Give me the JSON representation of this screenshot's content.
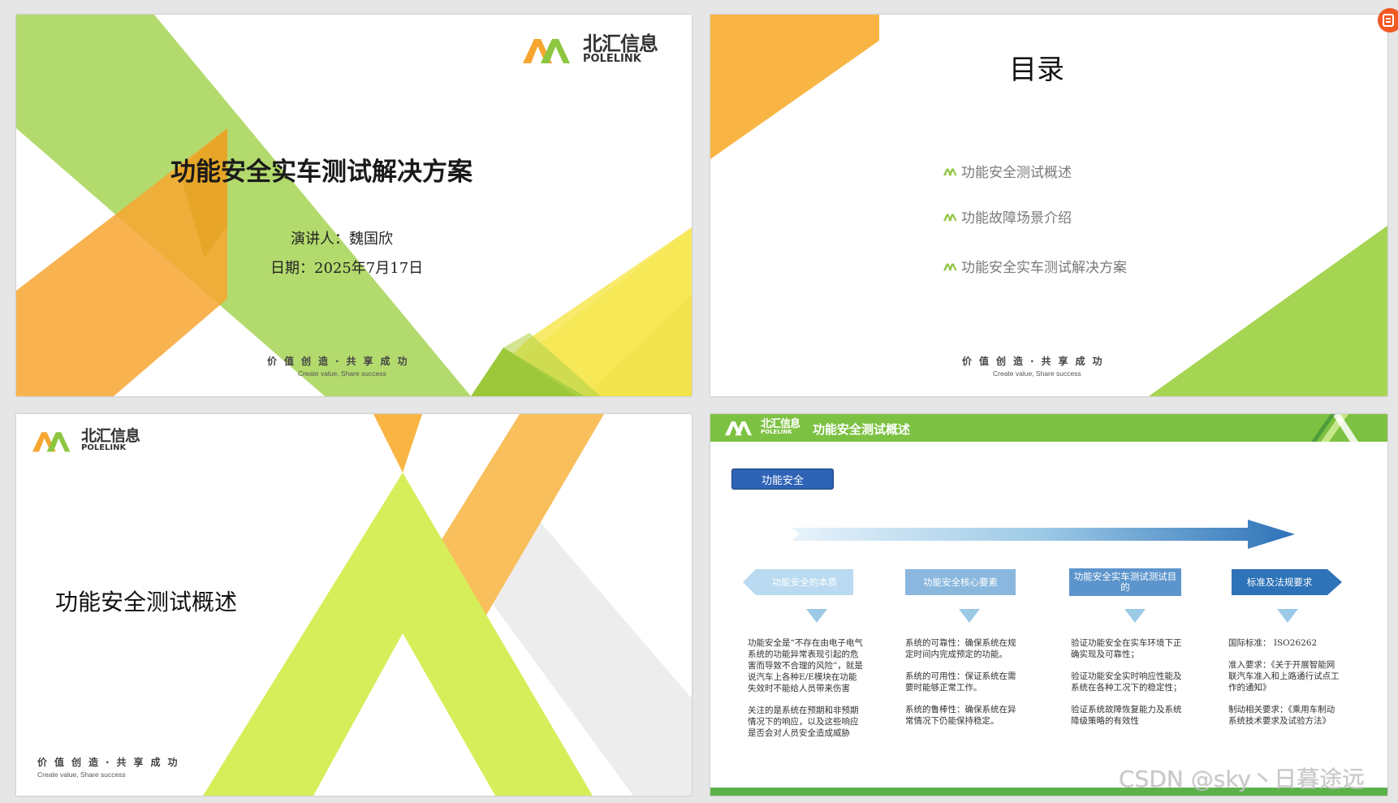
{
  "brand": {
    "name_cn": "北汇信息",
    "name_en": "POLELINK"
  },
  "slogan": {
    "cn": "价值创造·共享成功",
    "en": "Create value, Share success"
  },
  "slide1": {
    "title": "功能安全实车测试解决方案",
    "presenter": "演讲人：魏国欣",
    "date": "日期：2025年7月17日"
  },
  "slide2": {
    "title": "目录",
    "items": [
      "功能安全测试概述",
      "功能故障场景介绍",
      "功能安全实车测试解决方案"
    ]
  },
  "slide3": {
    "title": "功能安全测试概述"
  },
  "slide4": {
    "header_title": "功能安全测试概述",
    "tag": "功能安全",
    "columns": [
      {
        "title": "功能安全的本质",
        "paragraphs": [
          "功能安全是“不存在由电子电气系统的功能异常表现引起的危害而导致不合理的风险”，就是说汽车上各种E/E模块在功能失效时不能给人员带来伤害",
          "关注的是系统在预期和非预期情况下的响应，以及这些响应是否会对人员安全造成威胁"
        ]
      },
      {
        "title": "功能安全核心要素",
        "paragraphs": [
          "系统的可靠性：确保系统在规定时间内完成预定的功能。",
          "系统的可用性：保证系统在需要时能够正常工作。",
          "系统的鲁棒性：确保系统在异常情况下仍能保持稳定。"
        ]
      },
      {
        "title": "功能安全实车测试测试目的",
        "paragraphs": [
          "验证功能安全在实车环境下正确实现及可靠性；",
          "验证功能安全实时响应性能及系统在各种工况下的稳定性；",
          "验证系统故障恢复能力及系统降级策略的有效性"
        ]
      },
      {
        "title": "标准及法规要求",
        "paragraphs": [
          "国际标准： ISO26262",
          "准入要求：《关于开展智能网联汽车准入和上路通行试点工作的通知》",
          "制动相关要求：《乘用车制动系统技术要求及试验方法》"
        ]
      }
    ]
  },
  "watermark": "CSDN @sky丶日暮途远",
  "colors": {
    "green": "#8dc63f",
    "orange": "#f7a631",
    "yellow": "#f4e04d",
    "blue": "#2e72b8",
    "light_blue": "#9cc9e6"
  }
}
